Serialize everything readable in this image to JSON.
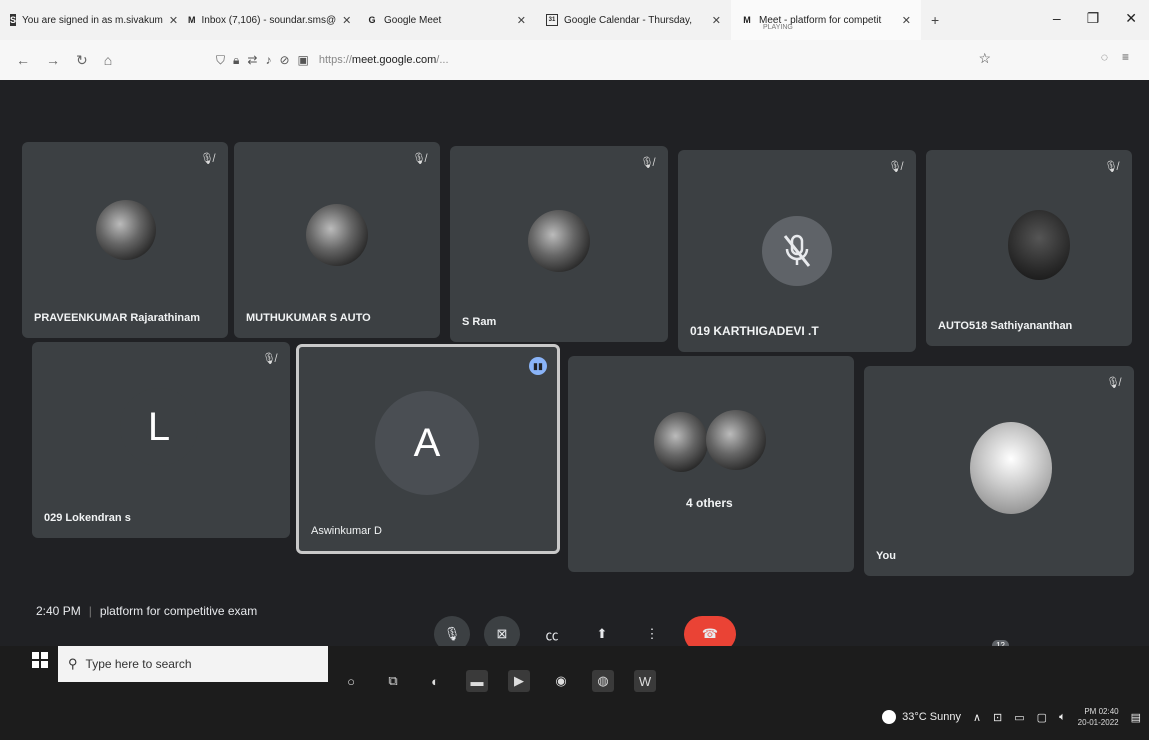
{
  "browser": {
    "tabs": [
      {
        "icon": "S",
        "title": "You are signed in as m.sivakum"
      },
      {
        "icon": "M",
        "title": "Inbox (7,106) - soundar.sms@"
      },
      {
        "icon": "G",
        "title": "Google Meet"
      },
      {
        "icon": "31",
        "title": "Google Calendar - Thursday,"
      },
      {
        "icon": "M",
        "title": "Meet - platform for competit",
        "subtitle": "PLAYING"
      }
    ],
    "url_prefix": "https://",
    "url_domain": "meet.google.com",
    "url_suffix": "/..."
  },
  "participants": [
    {
      "name": "PRAVEENKUMAR Rajarathinam",
      "avatar": "photo"
    },
    {
      "name": "MUTHUKUMAR S AUTO",
      "avatar": "photo"
    },
    {
      "name": "S Ram",
      "avatar": "photo"
    },
    {
      "name": "019 KARTHIGADEVI .T",
      "avatar": "muted"
    },
    {
      "name": "AUTO518 Sathiyananthan",
      "avatar": "dark"
    },
    {
      "name": "029 Lokendran s",
      "letter": "L"
    },
    {
      "name": "Aswinkumar D",
      "letter": "A"
    },
    {
      "name": "4 others"
    },
    {
      "name": "You"
    }
  ],
  "meeting": {
    "time": "2:40 PM",
    "title": "platform for competitive exam"
  },
  "people_count": "12",
  "taskbar": {
    "search_placeholder": "Type here to search",
    "weather": "33°C  Sunny",
    "clock_time": "PM 02:40",
    "clock_date": "20-01-2022"
  },
  "colors": {
    "meet_bg": "#202124",
    "tile_bg": "#3c4043",
    "end_call": "#ea4335"
  }
}
